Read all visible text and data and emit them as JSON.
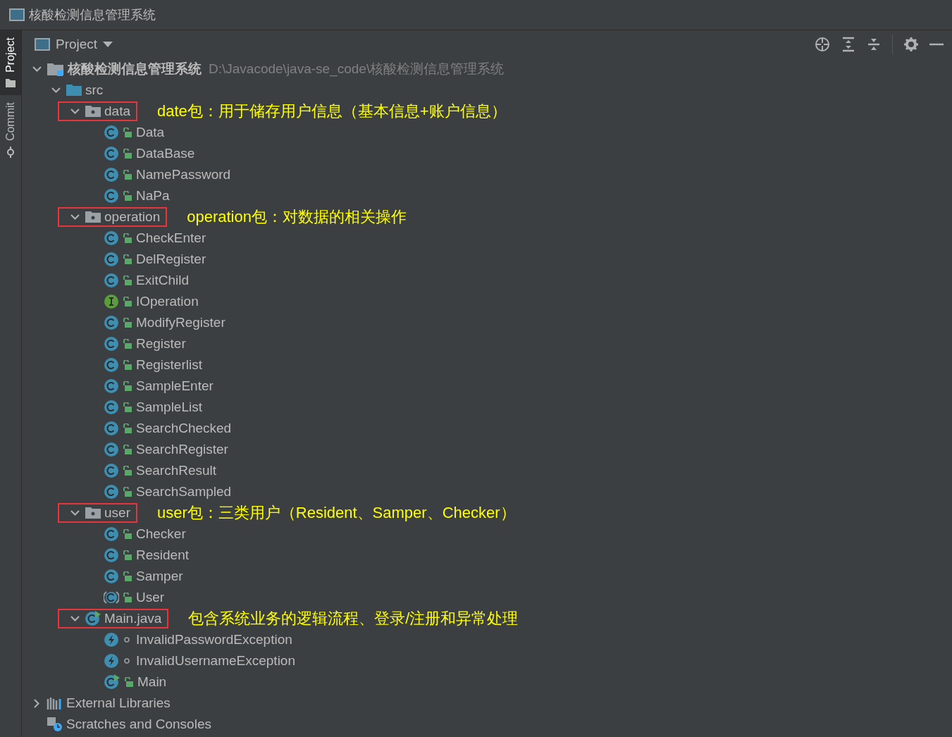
{
  "window": {
    "title": "核酸检测信息管理系统"
  },
  "side_tabs": [
    {
      "label": "Project",
      "selected": true
    },
    {
      "label": "Commit",
      "selected": false
    }
  ],
  "panel": {
    "title": "Project"
  },
  "tree": [
    {
      "kind": "project",
      "label": "核酸检测信息管理系统",
      "path": "D:\\Javacode\\java-se_code\\核酸检测信息管理系统",
      "expanded": true,
      "children": [
        {
          "kind": "source-folder",
          "label": "src",
          "expanded": true,
          "children": [
            {
              "kind": "package",
              "label": "data",
              "expanded": true,
              "highlighted": true,
              "note": "date包：用于储存用户信息（基本信息+账户信息）",
              "children": [
                {
                  "kind": "class",
                  "label": "Data",
                  "public": true
                },
                {
                  "kind": "class",
                  "label": "DataBase",
                  "public": true
                },
                {
                  "kind": "class",
                  "label": "NamePassword",
                  "public": true
                },
                {
                  "kind": "class",
                  "label": "NaPa",
                  "public": true
                }
              ]
            },
            {
              "kind": "package",
              "label": "operation",
              "expanded": true,
              "highlighted": true,
              "note": "operation包：对数据的相关操作",
              "children": [
                {
                  "kind": "class",
                  "label": "CheckEnter",
                  "public": true
                },
                {
                  "kind": "class",
                  "label": "DelRegister",
                  "public": true
                },
                {
                  "kind": "class",
                  "label": "ExitChild",
                  "public": true
                },
                {
                  "kind": "interface",
                  "label": "IOperation",
                  "public": true
                },
                {
                  "kind": "class",
                  "label": "ModifyRegister",
                  "public": true
                },
                {
                  "kind": "class",
                  "label": "Register",
                  "public": true
                },
                {
                  "kind": "class",
                  "label": "Registerlist",
                  "public": true
                },
                {
                  "kind": "class",
                  "label": "SampleEnter",
                  "public": true
                },
                {
                  "kind": "class",
                  "label": "SampleList",
                  "public": true
                },
                {
                  "kind": "class",
                  "label": "SearchChecked",
                  "public": true
                },
                {
                  "kind": "class",
                  "label": "SearchRegister",
                  "public": true
                },
                {
                  "kind": "class",
                  "label": "SearchResult",
                  "public": true
                },
                {
                  "kind": "class",
                  "label": "SearchSampled",
                  "public": true
                }
              ]
            },
            {
              "kind": "package",
              "label": "user",
              "expanded": true,
              "highlighted": true,
              "note": "user包：三类用户（Resident、Samper、Checker）",
              "children": [
                {
                  "kind": "class",
                  "label": "Checker",
                  "public": true
                },
                {
                  "kind": "class",
                  "label": "Resident",
                  "public": true
                },
                {
                  "kind": "class",
                  "label": "Samper",
                  "public": true
                },
                {
                  "kind": "abstract-class",
                  "label": "User",
                  "public": true
                }
              ]
            },
            {
              "kind": "java-file",
              "label": "Main.java",
              "expanded": true,
              "highlighted": true,
              "note": "包含系统业务的逻辑流程、登录/注册和异常处理",
              "children": [
                {
                  "kind": "exception",
                  "label": "InvalidPasswordException",
                  "public": false
                },
                {
                  "kind": "exception",
                  "label": "InvalidUsernameException",
                  "public": false
                },
                {
                  "kind": "main-class",
                  "label": "Main",
                  "public": true
                }
              ]
            }
          ]
        }
      ]
    },
    {
      "kind": "libraries",
      "label": "External Libraries",
      "expanded": false
    },
    {
      "kind": "scratches",
      "label": "Scratches and Consoles"
    }
  ]
}
